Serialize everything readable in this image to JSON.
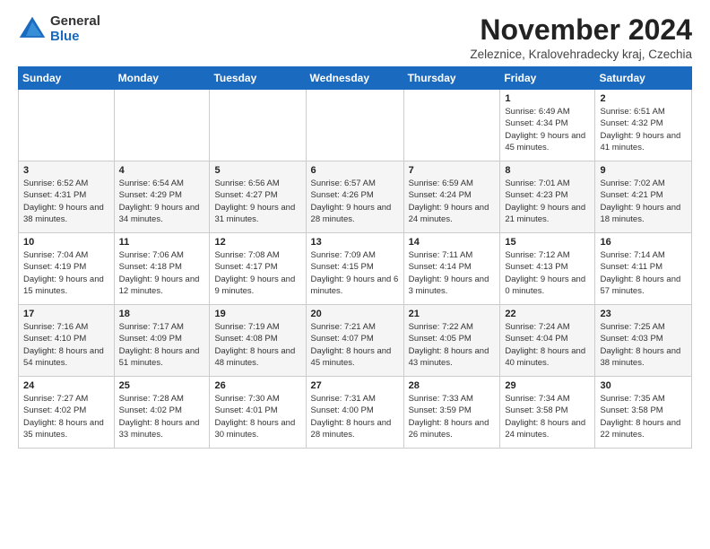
{
  "logo": {
    "general": "General",
    "blue": "Blue"
  },
  "title": "November 2024",
  "subtitle": "Zeleznice, Kralovehradecky kraj, Czechia",
  "days": [
    "Sunday",
    "Monday",
    "Tuesday",
    "Wednesday",
    "Thursday",
    "Friday",
    "Saturday"
  ],
  "weeks": [
    [
      {
        "day": "",
        "info": ""
      },
      {
        "day": "",
        "info": ""
      },
      {
        "day": "",
        "info": ""
      },
      {
        "day": "",
        "info": ""
      },
      {
        "day": "",
        "info": ""
      },
      {
        "day": "1",
        "info": "Sunrise: 6:49 AM\nSunset: 4:34 PM\nDaylight: 9 hours and 45 minutes."
      },
      {
        "day": "2",
        "info": "Sunrise: 6:51 AM\nSunset: 4:32 PM\nDaylight: 9 hours and 41 minutes."
      }
    ],
    [
      {
        "day": "3",
        "info": "Sunrise: 6:52 AM\nSunset: 4:31 PM\nDaylight: 9 hours and 38 minutes."
      },
      {
        "day": "4",
        "info": "Sunrise: 6:54 AM\nSunset: 4:29 PM\nDaylight: 9 hours and 34 minutes."
      },
      {
        "day": "5",
        "info": "Sunrise: 6:56 AM\nSunset: 4:27 PM\nDaylight: 9 hours and 31 minutes."
      },
      {
        "day": "6",
        "info": "Sunrise: 6:57 AM\nSunset: 4:26 PM\nDaylight: 9 hours and 28 minutes."
      },
      {
        "day": "7",
        "info": "Sunrise: 6:59 AM\nSunset: 4:24 PM\nDaylight: 9 hours and 24 minutes."
      },
      {
        "day": "8",
        "info": "Sunrise: 7:01 AM\nSunset: 4:23 PM\nDaylight: 9 hours and 21 minutes."
      },
      {
        "day": "9",
        "info": "Sunrise: 7:02 AM\nSunset: 4:21 PM\nDaylight: 9 hours and 18 minutes."
      }
    ],
    [
      {
        "day": "10",
        "info": "Sunrise: 7:04 AM\nSunset: 4:19 PM\nDaylight: 9 hours and 15 minutes."
      },
      {
        "day": "11",
        "info": "Sunrise: 7:06 AM\nSunset: 4:18 PM\nDaylight: 9 hours and 12 minutes."
      },
      {
        "day": "12",
        "info": "Sunrise: 7:08 AM\nSunset: 4:17 PM\nDaylight: 9 hours and 9 minutes."
      },
      {
        "day": "13",
        "info": "Sunrise: 7:09 AM\nSunset: 4:15 PM\nDaylight: 9 hours and 6 minutes."
      },
      {
        "day": "14",
        "info": "Sunrise: 7:11 AM\nSunset: 4:14 PM\nDaylight: 9 hours and 3 minutes."
      },
      {
        "day": "15",
        "info": "Sunrise: 7:12 AM\nSunset: 4:13 PM\nDaylight: 9 hours and 0 minutes."
      },
      {
        "day": "16",
        "info": "Sunrise: 7:14 AM\nSunset: 4:11 PM\nDaylight: 8 hours and 57 minutes."
      }
    ],
    [
      {
        "day": "17",
        "info": "Sunrise: 7:16 AM\nSunset: 4:10 PM\nDaylight: 8 hours and 54 minutes."
      },
      {
        "day": "18",
        "info": "Sunrise: 7:17 AM\nSunset: 4:09 PM\nDaylight: 8 hours and 51 minutes."
      },
      {
        "day": "19",
        "info": "Sunrise: 7:19 AM\nSunset: 4:08 PM\nDaylight: 8 hours and 48 minutes."
      },
      {
        "day": "20",
        "info": "Sunrise: 7:21 AM\nSunset: 4:07 PM\nDaylight: 8 hours and 45 minutes."
      },
      {
        "day": "21",
        "info": "Sunrise: 7:22 AM\nSunset: 4:05 PM\nDaylight: 8 hours and 43 minutes."
      },
      {
        "day": "22",
        "info": "Sunrise: 7:24 AM\nSunset: 4:04 PM\nDaylight: 8 hours and 40 minutes."
      },
      {
        "day": "23",
        "info": "Sunrise: 7:25 AM\nSunset: 4:03 PM\nDaylight: 8 hours and 38 minutes."
      }
    ],
    [
      {
        "day": "24",
        "info": "Sunrise: 7:27 AM\nSunset: 4:02 PM\nDaylight: 8 hours and 35 minutes."
      },
      {
        "day": "25",
        "info": "Sunrise: 7:28 AM\nSunset: 4:02 PM\nDaylight: 8 hours and 33 minutes."
      },
      {
        "day": "26",
        "info": "Sunrise: 7:30 AM\nSunset: 4:01 PM\nDaylight: 8 hours and 30 minutes."
      },
      {
        "day": "27",
        "info": "Sunrise: 7:31 AM\nSunset: 4:00 PM\nDaylight: 8 hours and 28 minutes."
      },
      {
        "day": "28",
        "info": "Sunrise: 7:33 AM\nSunset: 3:59 PM\nDaylight: 8 hours and 26 minutes."
      },
      {
        "day": "29",
        "info": "Sunrise: 7:34 AM\nSunset: 3:58 PM\nDaylight: 8 hours and 24 minutes."
      },
      {
        "day": "30",
        "info": "Sunrise: 7:35 AM\nSunset: 3:58 PM\nDaylight: 8 hours and 22 minutes."
      }
    ]
  ]
}
